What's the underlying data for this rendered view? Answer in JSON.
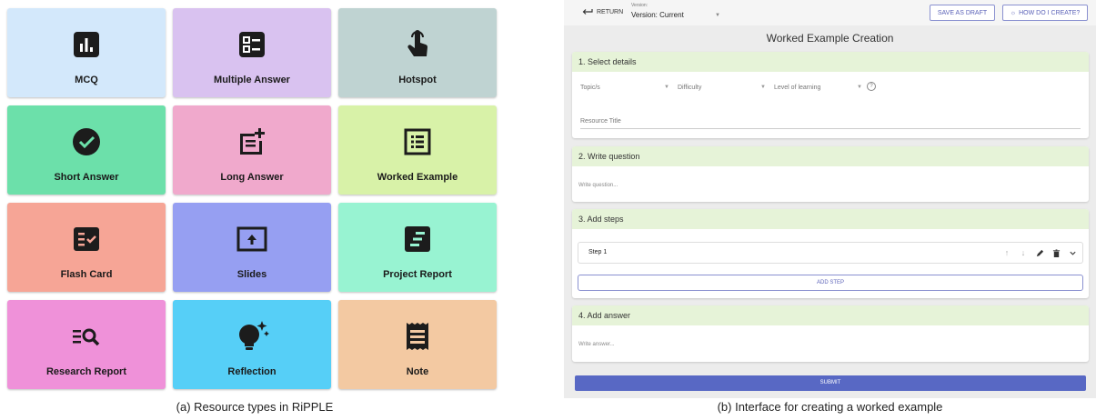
{
  "resource_grid": {
    "caption": "(a) Resource types in RiPPLE",
    "tiles": [
      {
        "label": "MCQ",
        "icon": "bar-chart-icon",
        "color": "#d3e8fb"
      },
      {
        "label": "Multiple Answer",
        "icon": "checklist-icon",
        "color": "#d9c2f0"
      },
      {
        "label": "Hotspot",
        "icon": "tap-icon",
        "color": "#bfd3d2"
      },
      {
        "label": "Short Answer",
        "icon": "check-circle-icon",
        "color": "#6ce0aa"
      },
      {
        "label": "Long Answer",
        "icon": "note-add-icon",
        "color": "#f0a9cc"
      },
      {
        "label": "Worked Example",
        "icon": "list-document-icon",
        "color": "#d8f2a8"
      },
      {
        "label": "Flash Card",
        "icon": "checklist-card-icon",
        "color": "#f6a596"
      },
      {
        "label": "Slides",
        "icon": "presentation-icon",
        "color": "#969ff2"
      },
      {
        "label": "Project Report",
        "icon": "report-icon",
        "color": "#98f3d2"
      },
      {
        "label": "Research Report",
        "icon": "search-list-icon",
        "color": "#ef91d9"
      },
      {
        "label": "Reflection",
        "icon": "lightbulb-icon",
        "color": "#56cff7"
      },
      {
        "label": "Note",
        "icon": "receipt-icon",
        "color": "#f3c9a2"
      }
    ]
  },
  "editor": {
    "caption": "(b) Interface for creating a worked example",
    "return_label": "RETURN",
    "version_label": "Version:",
    "version_value": "Version: Current",
    "save_draft_label": "SAVE AS DRAFT",
    "how_label": "HOW DO I CREATE?",
    "title": "Worked Example Creation",
    "section1": {
      "heading": "1. Select details",
      "topic_label": "Topic/s",
      "difficulty_label": "Difficulty",
      "level_label": "Level of learning",
      "resource_title_placeholder": "Resource Title"
    },
    "section2": {
      "heading": "2. Write question",
      "placeholder": "Write question..."
    },
    "section3": {
      "heading": "3. Add steps",
      "step_label": "Step 1",
      "add_step_label": "ADD STEP"
    },
    "section4": {
      "heading": "4. Add answer",
      "placeholder": "Write answer..."
    },
    "submit_label": "SUBMIT"
  }
}
